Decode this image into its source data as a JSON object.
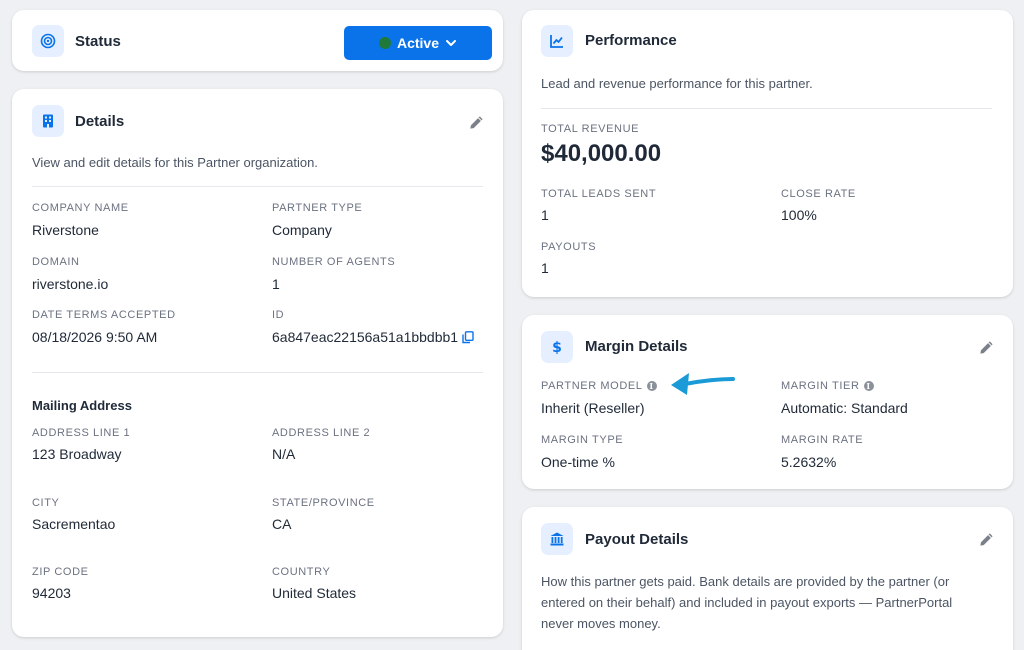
{
  "status": {
    "title": "Status",
    "button_label": "Active",
    "icon": "target-icon"
  },
  "details": {
    "title": "Details",
    "description": "View and edit details for this Partner organization.",
    "fields": {
      "company_name": {
        "label": "COMPANY NAME",
        "value": "Riverstone"
      },
      "partner_type": {
        "label": "PARTNER TYPE",
        "value": "Company"
      },
      "domain": {
        "label": "DOMAIN",
        "value": "riverstone.io"
      },
      "number_of_agents": {
        "label": "NUMBER OF AGENTS",
        "value": "1"
      },
      "date_terms_accepted": {
        "label": "DATE TERMS ACCEPTED",
        "value": "08/18/2026 9:50 AM"
      },
      "id": {
        "label": "ID",
        "value": "6a847eac22156a51a1bbdbb1"
      }
    },
    "mailing_address": {
      "heading": "Mailing Address",
      "address_line_1": {
        "label": "ADDRESS LINE 1",
        "value": "123 Broadway"
      },
      "address_line_2": {
        "label": "ADDRESS LINE 2",
        "value": "N/A"
      },
      "city": {
        "label": "CITY",
        "value": "Sacrementao"
      },
      "state": {
        "label": "STATE/PROVINCE",
        "value": "CA"
      },
      "zip": {
        "label": "ZIP CODE",
        "value": "94203"
      },
      "country": {
        "label": "COUNTRY",
        "value": "United States"
      }
    }
  },
  "performance": {
    "title": "Performance",
    "description": "Lead and revenue performance for this partner.",
    "total_revenue": {
      "label": "TOTAL REVENUE",
      "value": "$40,000.00"
    },
    "total_leads_sent": {
      "label": "TOTAL LEADS SENT",
      "value": "1"
    },
    "close_rate": {
      "label": "CLOSE RATE",
      "value": "100%"
    },
    "payouts": {
      "label": "PAYOUTS",
      "value": "1"
    }
  },
  "margin": {
    "title": "Margin Details",
    "partner_model": {
      "label": "PARTNER MODEL",
      "value": "Inherit (Reseller)"
    },
    "margin_tier": {
      "label": "MARGIN TIER",
      "value": "Automatic: Standard"
    },
    "margin_type": {
      "label": "MARGIN TYPE",
      "value": "One-time %"
    },
    "margin_rate": {
      "label": "MARGIN RATE",
      "value": "5.2632%"
    }
  },
  "payout": {
    "title": "Payout Details",
    "description": "How this partner gets paid. Bank details are provided by the partner (or entered on their behalf) and included in payout exports — PartnerPortal never moves money."
  },
  "colors": {
    "accent": "#0b73ea",
    "status_dot": "#1f7a3a",
    "icon_bg": "#e5efff",
    "annotation_arrow": "#1a9bd7"
  }
}
